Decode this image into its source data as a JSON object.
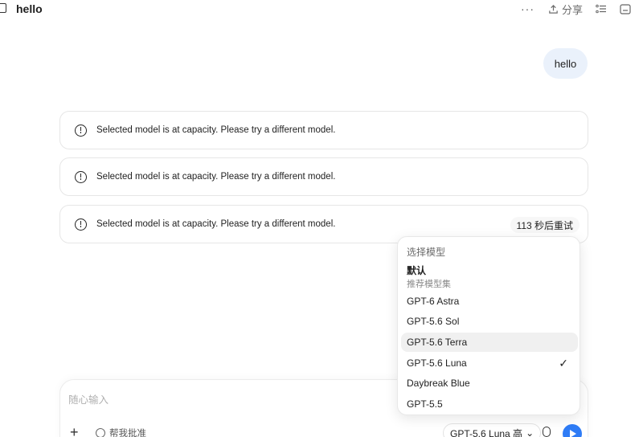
{
  "header": {
    "title": "hello",
    "share_label": "分享",
    "more_label": "···"
  },
  "user_message": "hello",
  "errors": [
    {
      "text": "Selected model is at capacity. Please try a different model."
    },
    {
      "text": "Selected model is at capacity. Please try a different model."
    },
    {
      "text": "Selected model is at capacity. Please try a different model.",
      "retry": "113 秒后重试"
    }
  ],
  "composer": {
    "placeholder": "随心输入",
    "help_label": "帮我批准",
    "model_label": "GPT-5.6 Luna 高",
    "chevron": "⌄"
  },
  "model_menu": {
    "heading": "选择模型",
    "default_label": "默认",
    "default_sub": "推荐模型集",
    "items": [
      {
        "label": "GPT-6 Astra"
      },
      {
        "label": "GPT-5.6 Sol"
      },
      {
        "label": "GPT-5.6 Terra"
      },
      {
        "label": "GPT-5.6 Luna"
      },
      {
        "label": "Daybreak Blue"
      },
      {
        "label": "GPT-5.5"
      }
    ],
    "checked_item": "GPT-5.6 Luna",
    "check_glyph": "✓"
  },
  "colors": {
    "accent": "#2f7cf6",
    "user_bubble": "#eaf1fb"
  }
}
